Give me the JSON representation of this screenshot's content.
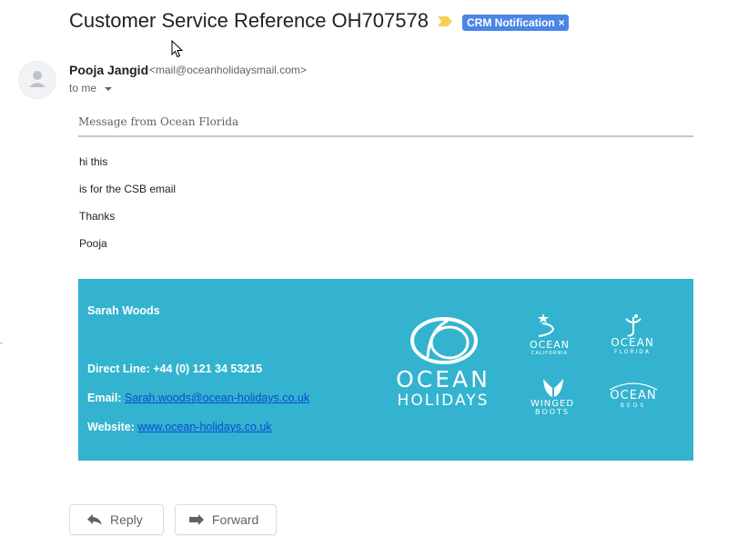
{
  "email": {
    "subject": "Customer Service Reference OH707578",
    "label": "CRM Notification",
    "label_close": "×",
    "sender_name": "Pooja Jangid",
    "sender_email": "<mail@oceanholidaysmail.com>",
    "to": "to me",
    "message_header": "Message from Ocean Florida",
    "body_lines": [
      "hi this",
      "is for the CSB email",
      "Thanks",
      "Pooja"
    ]
  },
  "signature": {
    "name": "Sarah Woods",
    "direct_line": "Direct Line: +44 (0) 121 34 53215",
    "email_label": "Email:",
    "email_link": "Sarah.woods@ocean-holidays.co.uk",
    "website_label": "Website:",
    "website_link": "www.ocean-holidays.co.uk",
    "logo_line1": "OCEAN",
    "logo_line2": "HOLIDAYS",
    "sub_brands": [
      {
        "name": "OCEAN",
        "sub": "CALIFORNIA"
      },
      {
        "name": "OCEAN",
        "sub": "FLORIDA"
      },
      {
        "name": "WINGED",
        "sub": "BOOTS"
      },
      {
        "name": "OCEAN",
        "sub": "BEDS"
      }
    ],
    "background_color": "#33b3cf"
  },
  "actions": {
    "reply": "Reply",
    "forward": "Forward"
  },
  "icons": [
    "important-marker-icon",
    "mouse-cursor-icon",
    "avatar-icon",
    "chevron-down-icon",
    "reply-icon",
    "forward-icon"
  ]
}
